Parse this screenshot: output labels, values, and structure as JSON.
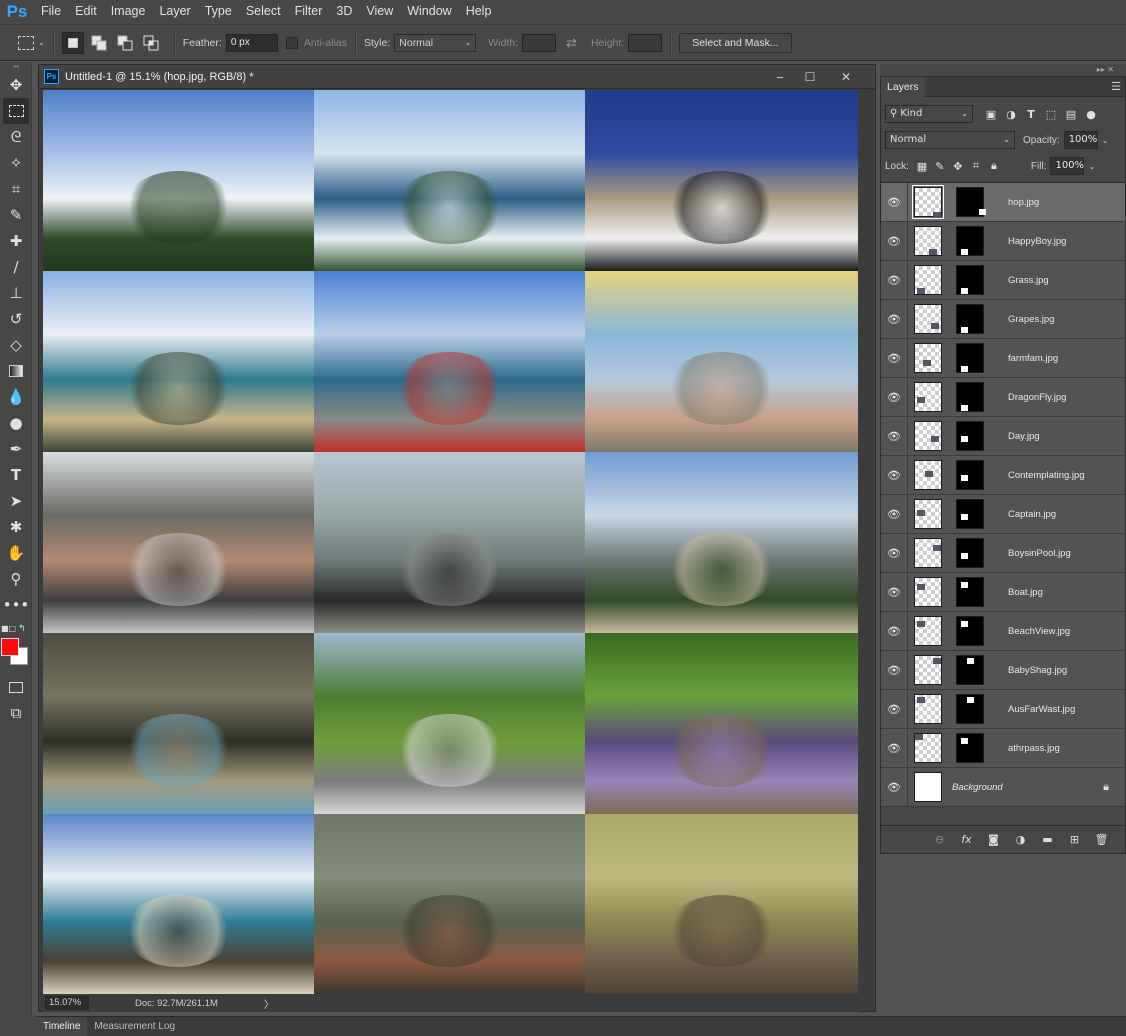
{
  "app": {
    "logo": "Ps"
  },
  "menu": [
    "File",
    "Edit",
    "Image",
    "Layer",
    "Type",
    "Select",
    "Filter",
    "3D",
    "View",
    "Window",
    "Help"
  ],
  "options": {
    "feather_label": "Feather:",
    "feather_value": "0 px",
    "antialias_label": "Anti-alias",
    "style_label": "Style:",
    "style_value": "Normal",
    "width_label": "Width:",
    "height_label": "Height:",
    "select_mask_label": "Select and Mask..."
  },
  "document": {
    "title": "Untitled-1 @ 15.1% (hop.jpg, RGB/8) *",
    "zoom": "15.07%",
    "doc_info": "Doc: 92.7M/261.1M",
    "status_arrow": "〉"
  },
  "tiles": [
    {
      "name": "mountain",
      "colors": [
        "#4f7fc8",
        "#a6c0e6",
        "#eef2f6",
        "#2f4a2a",
        "#243a1e"
      ]
    },
    {
      "name": "coast-aerial",
      "colors": [
        "#8eb6e2",
        "#d6e4f1",
        "#2d5d85",
        "#e7eef2",
        "#355630"
      ]
    },
    {
      "name": "bird-on-post",
      "colors": [
        "#243c8a",
        "#2f4aa0",
        "#a99c84",
        "#efefef",
        "#1a1a1a"
      ]
    },
    {
      "name": "bay-view",
      "colors": [
        "#8ab2e6",
        "#e9eef3",
        "#2f7a8e",
        "#c7b58a",
        "#3b4535"
      ]
    },
    {
      "name": "lighthouse",
      "colors": [
        "#4d80d2",
        "#b8cfe8",
        "#2d6b8a",
        "#8a8a86",
        "#c0302a"
      ]
    },
    {
      "name": "hot-pool",
      "colors": [
        "#e6d27c",
        "#8ab8d8",
        "#b3c9dd",
        "#caa088",
        "#7e7a6a"
      ]
    },
    {
      "name": "captain",
      "colors": [
        "#d7dde1",
        "#6b6b64",
        "#b48a72",
        "#3d3d3d",
        "#c6c6c6"
      ]
    },
    {
      "name": "beach-walk",
      "colors": [
        "#b8c6d2",
        "#9aa7a8",
        "#6f7a78",
        "#2a2a2a",
        "#8b8f88"
      ]
    },
    {
      "name": "town-view",
      "colors": [
        "#6f9bd2",
        "#c9d7e6",
        "#6d7774",
        "#2f4a25",
        "#c7b9a0"
      ]
    },
    {
      "name": "dragonfly",
      "colors": [
        "#4d4c40",
        "#767561",
        "#2f2f27",
        "#a49c7e",
        "#6aa0b8"
      ]
    },
    {
      "name": "farm",
      "colors": [
        "#9fb7cf",
        "#4c7d32",
        "#6f9d3c",
        "#7d7d7d",
        "#d8d8d8"
      ]
    },
    {
      "name": "grapes",
      "colors": [
        "#3a6a22",
        "#6aa03c",
        "#5a4a7d",
        "#9a86b8",
        "#7d6a55"
      ]
    },
    {
      "name": "beach-rocks",
      "colors": [
        "#5c86c8",
        "#e8eef4",
        "#2f7c95",
        "#4a4134",
        "#d9d2bd"
      ]
    },
    {
      "name": "boy-swimming",
      "colors": [
        "#6f7868",
        "#838c7c",
        "#5a6352",
        "#8b5a40",
        "#3a3a30"
      ]
    },
    {
      "name": "kangaroo",
      "colors": [
        "#a9a869",
        "#bdb981",
        "#8e8850",
        "#6e5e4c",
        "#504236"
      ]
    }
  ],
  "layers_panel": {
    "tab_label": "Layers",
    "filter_label": "Kind",
    "blend_mode": "Normal",
    "opacity_label": "Opacity:",
    "opacity_value": "100%",
    "lock_label": "Lock:",
    "fill_label": "Fill:",
    "fill_value": "100%",
    "layers": [
      {
        "name": "hop.jpg",
        "selected": true
      },
      {
        "name": "HappyBoy.jpg",
        "selected": false
      },
      {
        "name": "Grass.jpg",
        "selected": false
      },
      {
        "name": "Grapes.jpg",
        "selected": false
      },
      {
        "name": "farmfam.jpg",
        "selected": false
      },
      {
        "name": "DragonFly.jpg",
        "selected": false
      },
      {
        "name": "Day.jpg",
        "selected": false
      },
      {
        "name": "Contemplating.jpg",
        "selected": false
      },
      {
        "name": "Captain.jpg",
        "selected": false
      },
      {
        "name": "BoysinPool.jpg",
        "selected": false
      },
      {
        "name": "Boat.jpg",
        "selected": false
      },
      {
        "name": "BeachView.jpg",
        "selected": false
      },
      {
        "name": "BabyShag.jpg",
        "selected": false
      },
      {
        "name": "AusFarWast.jpg",
        "selected": false
      },
      {
        "name": "athrpass.jpg",
        "selected": false
      }
    ],
    "background_layer": "Background"
  },
  "bottom_tabs": [
    "Timeline",
    "Measurement Log"
  ],
  "colors": {
    "foreground": "#ff0a0a",
    "background": "#ffffff",
    "accent": "#31a8ff"
  }
}
